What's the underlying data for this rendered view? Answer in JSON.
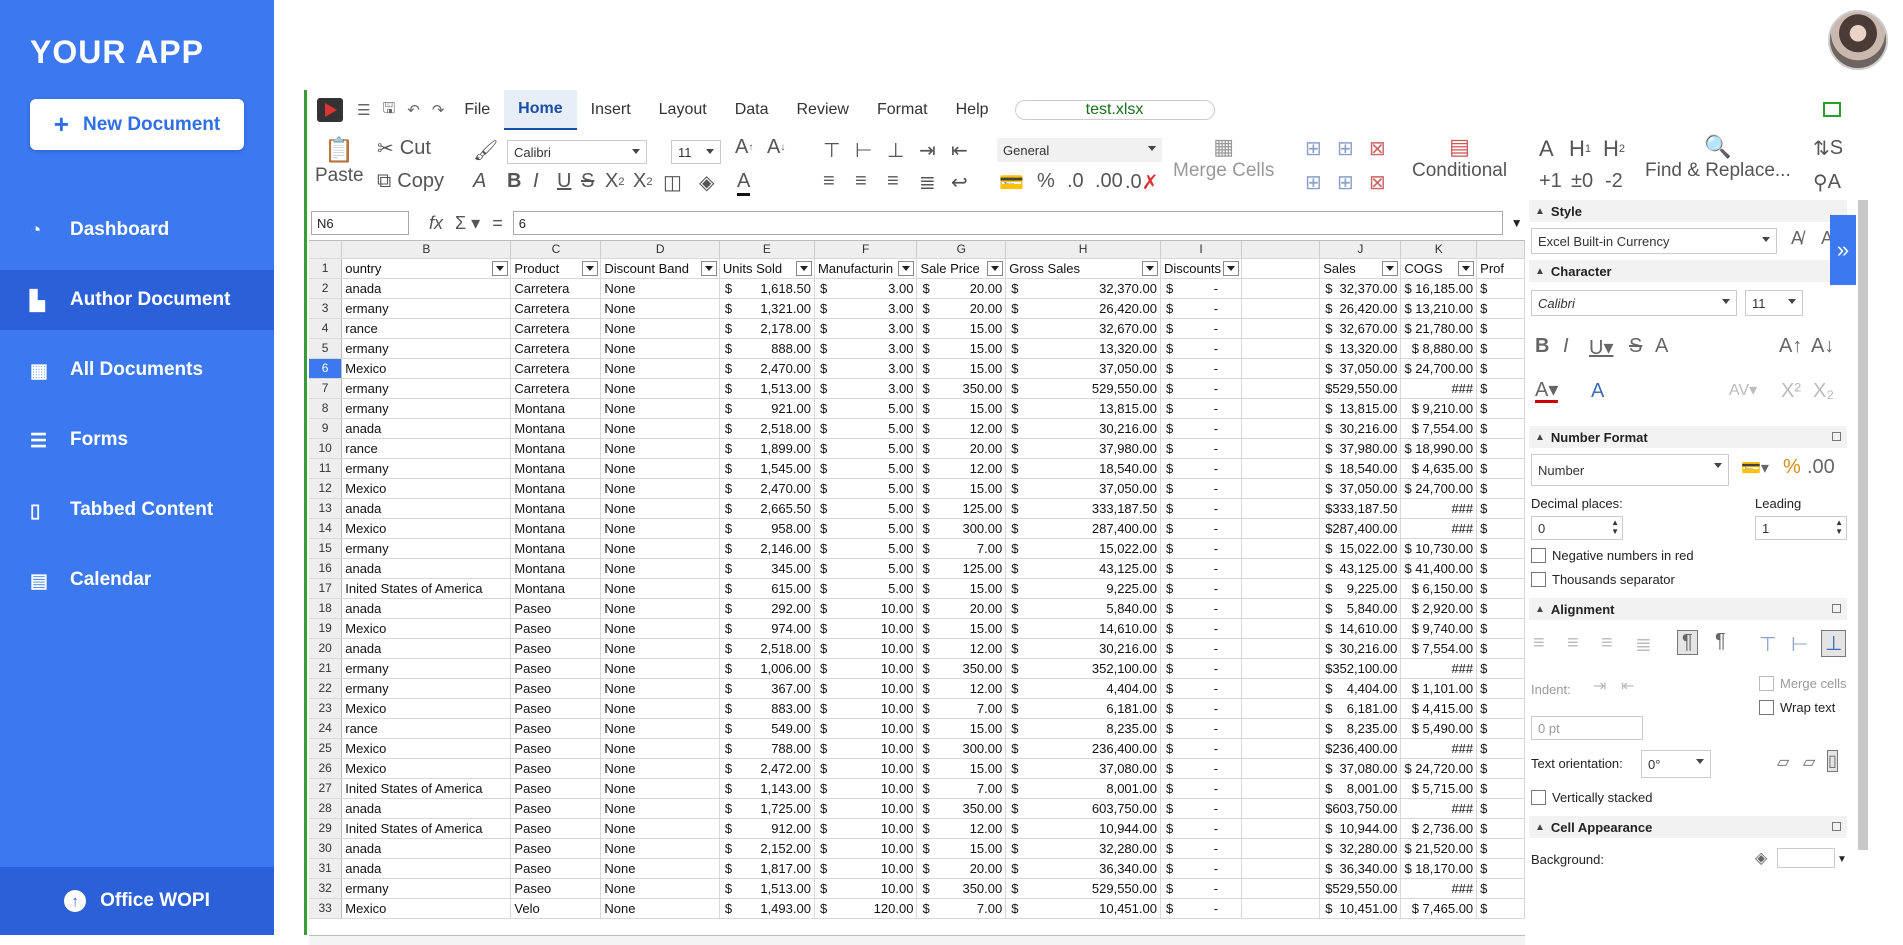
{
  "app": {
    "brand": "YOUR APP",
    "new_document": "New Document",
    "footer": "Office WOPI"
  },
  "nav": [
    {
      "label": "Dashboard",
      "icon": "dashboard-icon",
      "active": false
    },
    {
      "label": "Author Document",
      "icon": "document-icon",
      "active": true
    },
    {
      "label": "All Documents",
      "icon": "grid-icon",
      "active": false
    },
    {
      "label": "Forms",
      "icon": "lines-icon",
      "active": false
    },
    {
      "label": "Tabbed Content",
      "icon": "tablet-icon",
      "active": false
    },
    {
      "label": "Calendar",
      "icon": "calendar-icon",
      "active": false
    }
  ],
  "menubar": {
    "items": [
      "File",
      "Home",
      "Insert",
      "Layout",
      "Data",
      "Review",
      "Format",
      "Help"
    ],
    "active": "Home",
    "filename": "test.xlsx"
  },
  "toolbar": {
    "paste": "Paste",
    "cut": "Cut",
    "copy": "Copy",
    "font": "Calibri",
    "size": "11",
    "number_format": "General",
    "merge": "Merge Cells",
    "conditional": "Conditional",
    "find_replace": "Find & Replace...",
    "sort": "S",
    "filter": "A"
  },
  "formula": {
    "cell": "N6",
    "value": "6"
  },
  "grid": {
    "columns": [
      "B",
      "C",
      "D",
      "E",
      "F",
      "G",
      "H",
      "I",
      "J",
      "K",
      ""
    ],
    "headers": [
      "ountry",
      "Product",
      "Discount Band",
      "Units Sold",
      "Manufacturin",
      "Sale Price",
      "Gross Sales",
      "Discounts",
      "Sales",
      "COGS",
      "Prof"
    ],
    "active_row": "6",
    "rows": [
      {
        "n": "2",
        "c": [
          "anada",
          "Carretera",
          "None",
          "1,618.50",
          "3.00",
          "20.00",
          "32,370.00",
          "-",
          "32,370.00",
          "$ 16,185.00",
          "$"
        ]
      },
      {
        "n": "3",
        "c": [
          "ermany",
          "Carretera",
          "None",
          "1,321.00",
          "3.00",
          "20.00",
          "26,420.00",
          "-",
          "26,420.00",
          "$ 13,210.00",
          "$"
        ]
      },
      {
        "n": "4",
        "c": [
          "rance",
          "Carretera",
          "None",
          "2,178.00",
          "3.00",
          "15.00",
          "32,670.00",
          "-",
          "32,670.00",
          "$ 21,780.00",
          "$"
        ]
      },
      {
        "n": "5",
        "c": [
          "ermany",
          "Carretera",
          "None",
          "888.00",
          "3.00",
          "15.00",
          "13,320.00",
          "-",
          "13,320.00",
          "$ 8,880.00",
          "$"
        ]
      },
      {
        "n": "6",
        "c": [
          "Mexico",
          "Carretera",
          "None",
          "2,470.00",
          "3.00",
          "15.00",
          "37,050.00",
          "-",
          "37,050.00",
          "$ 24,700.00",
          "$"
        ]
      },
      {
        "n": "7",
        "c": [
          "ermany",
          "Carretera",
          "None",
          "1,513.00",
          "3.00",
          "350.00",
          "529,550.00",
          "-",
          "529,550.00",
          "###",
          "$"
        ]
      },
      {
        "n": "8",
        "c": [
          "ermany",
          "Montana",
          "None",
          "921.00",
          "5.00",
          "15.00",
          "13,815.00",
          "-",
          "13,815.00",
          "$ 9,210.00",
          "$"
        ]
      },
      {
        "n": "9",
        "c": [
          "anada",
          "Montana",
          "None",
          "2,518.00",
          "5.00",
          "12.00",
          "30,216.00",
          "-",
          "30,216.00",
          "$ 7,554.00",
          "$"
        ]
      },
      {
        "n": "10",
        "c": [
          "rance",
          "Montana",
          "None",
          "1,899.00",
          "5.00",
          "20.00",
          "37,980.00",
          "-",
          "37,980.00",
          "$ 18,990.00",
          "$"
        ]
      },
      {
        "n": "11",
        "c": [
          "ermany",
          "Montana",
          "None",
          "1,545.00",
          "5.00",
          "12.00",
          "18,540.00",
          "-",
          "18,540.00",
          "$ 4,635.00",
          "$"
        ]
      },
      {
        "n": "12",
        "c": [
          "Mexico",
          "Montana",
          "None",
          "2,470.00",
          "5.00",
          "15.00",
          "37,050.00",
          "-",
          "37,050.00",
          "$ 24,700.00",
          "$"
        ]
      },
      {
        "n": "13",
        "c": [
          "anada",
          "Montana",
          "None",
          "2,665.50",
          "5.00",
          "125.00",
          "333,187.50",
          "-",
          "333,187.50",
          "###",
          "$"
        ]
      },
      {
        "n": "14",
        "c": [
          "Mexico",
          "Montana",
          "None",
          "958.00",
          "5.00",
          "300.00",
          "287,400.00",
          "-",
          "287,400.00",
          "###",
          "$"
        ]
      },
      {
        "n": "15",
        "c": [
          "ermany",
          "Montana",
          "None",
          "2,146.00",
          "5.00",
          "7.00",
          "15,022.00",
          "-",
          "15,022.00",
          "$ 10,730.00",
          "$"
        ]
      },
      {
        "n": "16",
        "c": [
          "anada",
          "Montana",
          "None",
          "345.00",
          "5.00",
          "125.00",
          "43,125.00",
          "-",
          "43,125.00",
          "$ 41,400.00",
          "$"
        ]
      },
      {
        "n": "17",
        "c": [
          "Inited States of America",
          "Montana",
          "None",
          "615.00",
          "5.00",
          "15.00",
          "9,225.00",
          "-",
          "9,225.00",
          "$ 6,150.00",
          "$"
        ]
      },
      {
        "n": "18",
        "c": [
          "anada",
          "Paseo",
          "None",
          "292.00",
          "10.00",
          "20.00",
          "5,840.00",
          "-",
          "5,840.00",
          "$ 2,920.00",
          "$"
        ]
      },
      {
        "n": "19",
        "c": [
          "Mexico",
          "Paseo",
          "None",
          "974.00",
          "10.00",
          "15.00",
          "14,610.00",
          "-",
          "14,610.00",
          "$ 9,740.00",
          "$"
        ]
      },
      {
        "n": "20",
        "c": [
          "anada",
          "Paseo",
          "None",
          "2,518.00",
          "10.00",
          "12.00",
          "30,216.00",
          "-",
          "30,216.00",
          "$ 7,554.00",
          "$"
        ]
      },
      {
        "n": "21",
        "c": [
          "ermany",
          "Paseo",
          "None",
          "1,006.00",
          "10.00",
          "350.00",
          "352,100.00",
          "-",
          "352,100.00",
          "###",
          "$"
        ]
      },
      {
        "n": "22",
        "c": [
          "ermany",
          "Paseo",
          "None",
          "367.00",
          "10.00",
          "12.00",
          "4,404.00",
          "-",
          "4,404.00",
          "$ 1,101.00",
          "$"
        ]
      },
      {
        "n": "23",
        "c": [
          "Mexico",
          "Paseo",
          "None",
          "883.00",
          "10.00",
          "7.00",
          "6,181.00",
          "-",
          "6,181.00",
          "$ 4,415.00",
          "$"
        ]
      },
      {
        "n": "24",
        "c": [
          "rance",
          "Paseo",
          "None",
          "549.00",
          "10.00",
          "15.00",
          "8,235.00",
          "-",
          "8,235.00",
          "$ 5,490.00",
          "$"
        ]
      },
      {
        "n": "25",
        "c": [
          "Mexico",
          "Paseo",
          "None",
          "788.00",
          "10.00",
          "300.00",
          "236,400.00",
          "-",
          "236,400.00",
          "###",
          "$"
        ]
      },
      {
        "n": "26",
        "c": [
          "Mexico",
          "Paseo",
          "None",
          "2,472.00",
          "10.00",
          "15.00",
          "37,080.00",
          "-",
          "37,080.00",
          "$ 24,720.00",
          "$"
        ]
      },
      {
        "n": "27",
        "c": [
          "Inited States of America",
          "Paseo",
          "None",
          "1,143.00",
          "10.00",
          "7.00",
          "8,001.00",
          "-",
          "8,001.00",
          "$ 5,715.00",
          "$"
        ]
      },
      {
        "n": "28",
        "c": [
          "anada",
          "Paseo",
          "None",
          "1,725.00",
          "10.00",
          "350.00",
          "603,750.00",
          "-",
          "603,750.00",
          "###",
          "$"
        ]
      },
      {
        "n": "29",
        "c": [
          "Inited States of America",
          "Paseo",
          "None",
          "912.00",
          "10.00",
          "12.00",
          "10,944.00",
          "-",
          "10,944.00",
          "$ 2,736.00",
          "$"
        ]
      },
      {
        "n": "30",
        "c": [
          "anada",
          "Paseo",
          "None",
          "2,152.00",
          "10.00",
          "15.00",
          "32,280.00",
          "-",
          "32,280.00",
          "$ 21,520.00",
          "$"
        ]
      },
      {
        "n": "31",
        "c": [
          "anada",
          "Paseo",
          "None",
          "1,817.00",
          "10.00",
          "20.00",
          "36,340.00",
          "-",
          "36,340.00",
          "$ 18,170.00",
          "$"
        ]
      },
      {
        "n": "32",
        "c": [
          "ermany",
          "Paseo",
          "None",
          "1,513.00",
          "10.00",
          "350.00",
          "529,550.00",
          "-",
          "529,550.00",
          "###",
          "$"
        ]
      },
      {
        "n": "33",
        "c": [
          "Mexico",
          "Velo",
          "None",
          "1,493.00",
          "120.00",
          "7.00",
          "10,451.00",
          "-",
          "10,451.00",
          "$ 7,465.00",
          "$"
        ]
      }
    ]
  },
  "panel": {
    "style_title": "Style",
    "style_value": "Excel Built-in Currency",
    "character_title": "Character",
    "font": "Calibri",
    "size": "11",
    "number_format_title": "Number Format",
    "number_format": "Number",
    "decimal_label": "Decimal places:",
    "decimal_value": "0",
    "leading_label": "Leading zeroes:",
    "leading_value": "1",
    "negative_red": "Negative numbers in red",
    "thousands": "Thousands separator",
    "alignment_title": "Alignment",
    "indent_label": "Indent:",
    "indent_value": "0 pt",
    "merge_cells": "Merge cells",
    "wrap_text": "Wrap text",
    "orientation_label": "Text orientation:",
    "orientation_value": "0°",
    "vertically_stacked": "Vertically stacked",
    "appearance_title": "Cell Appearance",
    "background_label": "Background:"
  }
}
